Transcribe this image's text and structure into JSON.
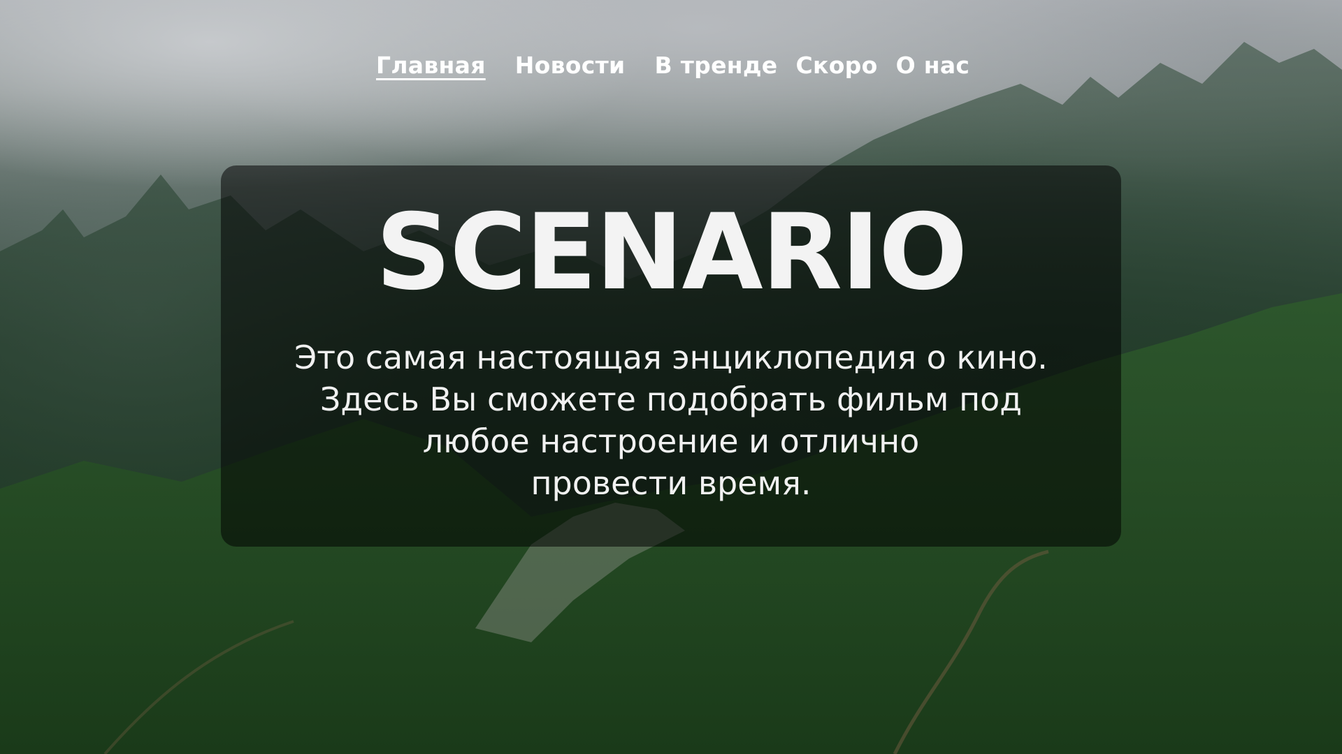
{
  "nav": {
    "items": [
      {
        "label": "Главная",
        "active": true
      },
      {
        "label": "Новости",
        "active": false
      },
      {
        "label": "В тренде",
        "active": false
      },
      {
        "label": "Скоро",
        "active": false
      },
      {
        "label": "О нас",
        "active": false
      }
    ]
  },
  "hero": {
    "title": "SCENARIO",
    "lines": [
      "Это самая настоящая энциклопедия о кино.",
      "Здесь Вы сможете подобрать фильм под",
      "любое настроение и отлично",
      "провести время."
    ]
  },
  "colors": {
    "text": "#ffffff",
    "panel": "rgba(0,0,0,0.52)",
    "forest": "#203a26",
    "mist": "#a9adb1"
  }
}
